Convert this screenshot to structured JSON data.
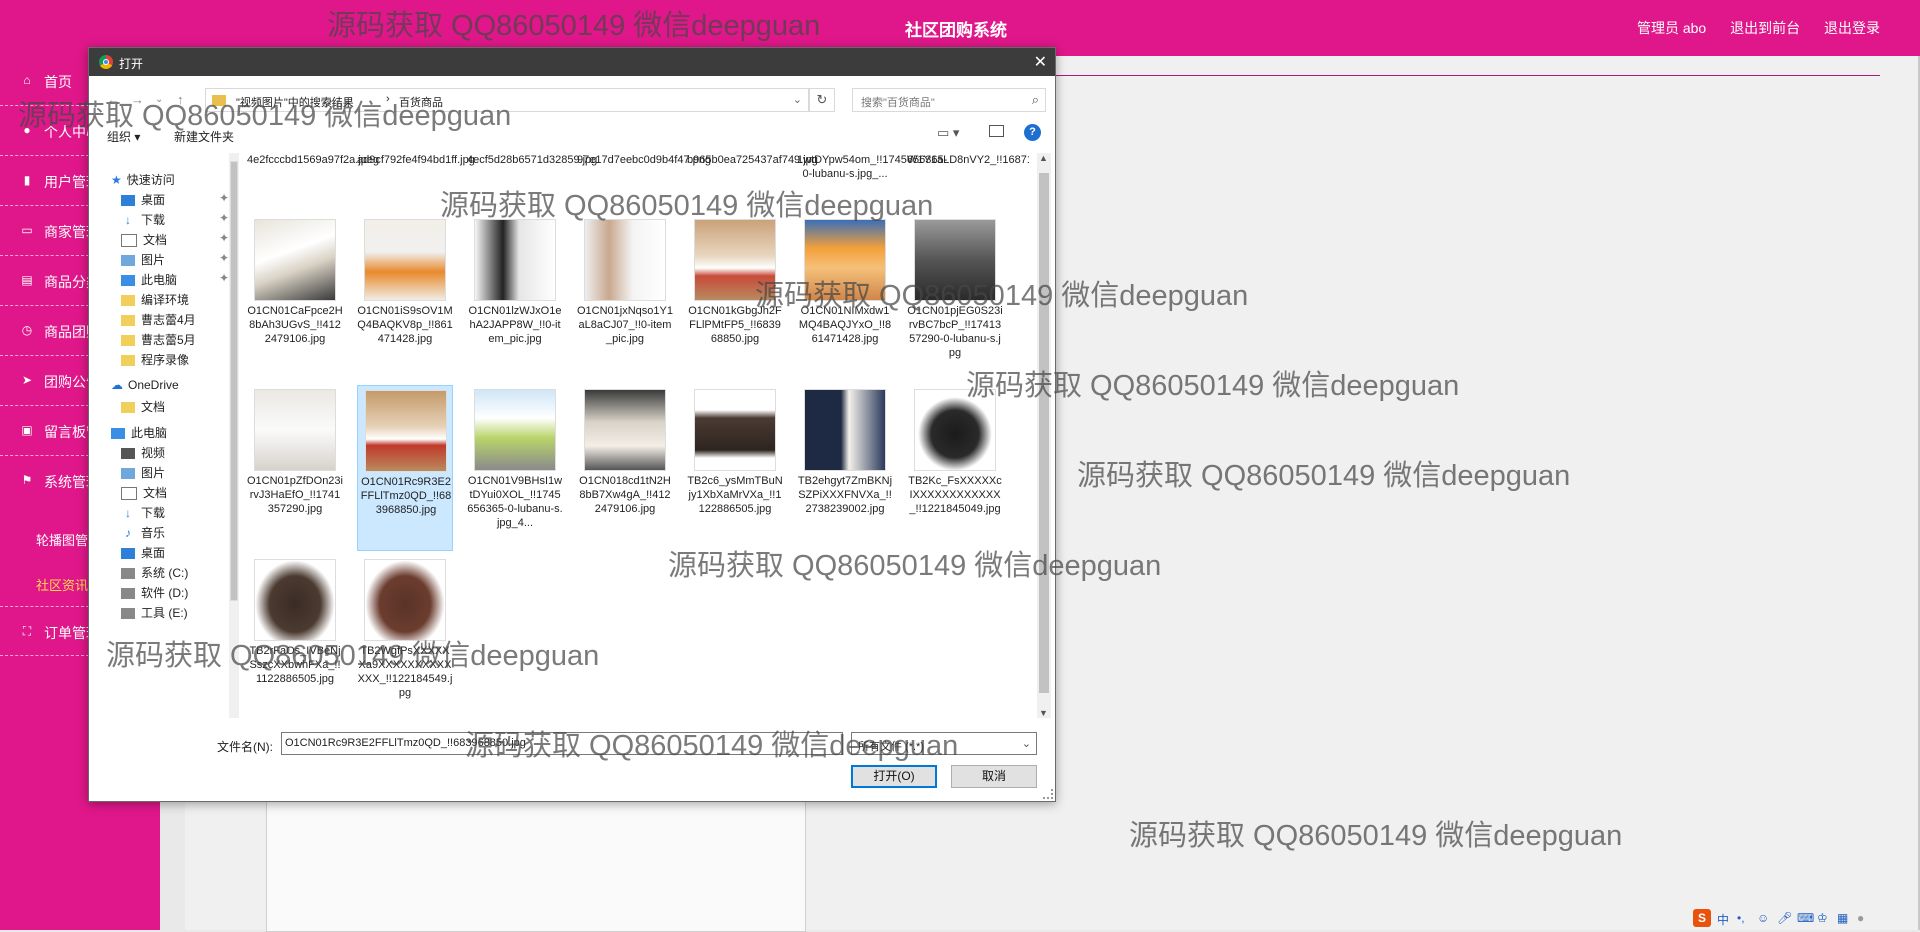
{
  "header": {
    "site_title": "社区团购系统",
    "admin_label": "管理员 abo",
    "back_front": "退出到前台",
    "logout": "退出登录"
  },
  "sidebar": {
    "items": [
      {
        "label": "首页",
        "icon": "home-icon"
      },
      {
        "label": "个人中心",
        "icon": "user-icon"
      },
      {
        "label": "用户管理",
        "icon": "chart-icon"
      },
      {
        "label": "商家管理",
        "icon": "store-icon"
      },
      {
        "label": "商品分类",
        "icon": "category-icon"
      },
      {
        "label": "商品团购",
        "icon": "clock-icon"
      },
      {
        "label": "团购公告",
        "icon": "send-icon"
      },
      {
        "label": "留言板管理",
        "icon": "message-icon"
      },
      {
        "label": "系统管理",
        "icon": "flag-icon"
      }
    ],
    "sub_items": [
      {
        "label": "轮播图管理",
        "active": false
      },
      {
        "label": "社区资讯",
        "active": true
      }
    ],
    "order_item": {
      "label": "订单管理",
      "icon": "order-icon"
    }
  },
  "watermark": "源码获取 QQ86050149 微信deepguan",
  "dialog": {
    "title": "打开",
    "path_part1": "\"视频图片\"中的搜索结果",
    "path_part2": "百货商品",
    "search_placeholder": "搜索\"百货商品\"",
    "organize": "组织 ▾",
    "new_folder": "新建文件夹",
    "nav": {
      "quick_access": "快速访问",
      "quick_items": [
        "桌面",
        "下载",
        "文档",
        "图片",
        "此电脑",
        "编译环境",
        "曹志蕾4月",
        "曹志蕾5月",
        "程序录像"
      ],
      "onedrive": "OneDrive",
      "onedrive_items": [
        "文档"
      ],
      "this_pc": "此电脑",
      "pc_items": [
        "视频",
        "图片",
        "文档",
        "下载",
        "音乐",
        "桌面",
        "系统 (C:)",
        "软件 (D:)",
        "工具 (E:)"
      ]
    },
    "top_row_names": [
      "4e2fcccbd1569a97f2a.jpeg",
      "ad9cf792fe4f94bd1ff.jpg",
      "4ecf5d28b6571d32859.jpg",
      "97e17d7eebc0d9b4f47.png",
      "b965b0ea725437af749.jpg",
      "1wtDYpw54om_!!1745656365-0-lubanu-s.jpg_...",
      "W1Y1aLD8nVY2_!!1687142999.jpg"
    ],
    "files": [
      {
        "name": "O1CN01CaFpce2H8bAh3UGvS_!!4122479106.jpg",
        "kind": "sneaker-white"
      },
      {
        "name": "O1CN01iS9sOV1MQ4BAQKV8p_!!861471428.jpg",
        "kind": "sneaker-orange"
      },
      {
        "name": "O1CN01lzWJxO1ehA2JAPP8W_!!0-item_pic.jpg",
        "kind": "model-black"
      },
      {
        "name": "O1CN01jxNqso1Y1aL8aCJ07_!!0-item_pic.jpg",
        "kind": "model-white"
      },
      {
        "name": "O1CN01kGbgJh2FFLlPMtFP5_!!683968850.jpg",
        "kind": "sneaker-red"
      },
      {
        "name": "O1CN01NIMxdw1MQ4BAQJYxO_!!861471428.jpg",
        "kind": "sneaker-orange2"
      },
      {
        "name": "O1CN01pjEG0S23irvBC7bcP_!!1741357290-0-lubanu-s.jpg",
        "kind": "boot-grey"
      },
      {
        "name": "O1CN01pZfDOn23irvJ3HaEfO_!!1741357290.jpg",
        "kind": "boot-white"
      },
      {
        "name": "O1CN01Rc9R3E2FFLlTmz0QD_!!683968850.jpg",
        "kind": "sneaker-red2",
        "selected": true
      },
      {
        "name": "O1CN01V9BHsI1wtDYui0XOL_!!1745656365-0-lubanu-s.jpg_4...",
        "kind": "sneaker-road"
      },
      {
        "name": "O1CN018cd1tN2H8bB7Xw4gA_!!4122479106.jpg",
        "kind": "loafer-cream"
      },
      {
        "name": "TB2c6_ysMmTBuNjy1XbXaMrVXa_!!1122886505.jpg",
        "kind": "clutch-brown"
      },
      {
        "name": "TB2ehgyt7ZmBKNjSZPiXXXFNVXa_!!2738239002.jpg",
        "kind": "bag-white"
      },
      {
        "name": "TB2Kc_FsXXXXXcIXXXXXXXXXXXX_!!1221845049.jpg",
        "kind": "bag-black"
      },
      {
        "name": "TB2rFaOs_IVBeNjSszcXXbwhFXa_!!1122886505.jpg",
        "kind": "briefcase-brown"
      },
      {
        "name": "TB2WgfPsXXXXXXa9XXXXXXXXXXXXX_!!122184549.jpg",
        "kind": "tote-brown"
      }
    ],
    "filename_label": "文件名(N):",
    "filename_value": "O1CN01Rc9R3E2FFLlTmz0QD_!!683968850.jpg",
    "filetype_value": "所有文件 (*.*)",
    "open_button": "打开(O)",
    "cancel_button": "取消"
  },
  "tray": {
    "ime": "S",
    "lang": "中"
  },
  "colors": {
    "brand": "#e0178a",
    "active_sub": "#ffd84d",
    "selection": "#cce8ff"
  }
}
